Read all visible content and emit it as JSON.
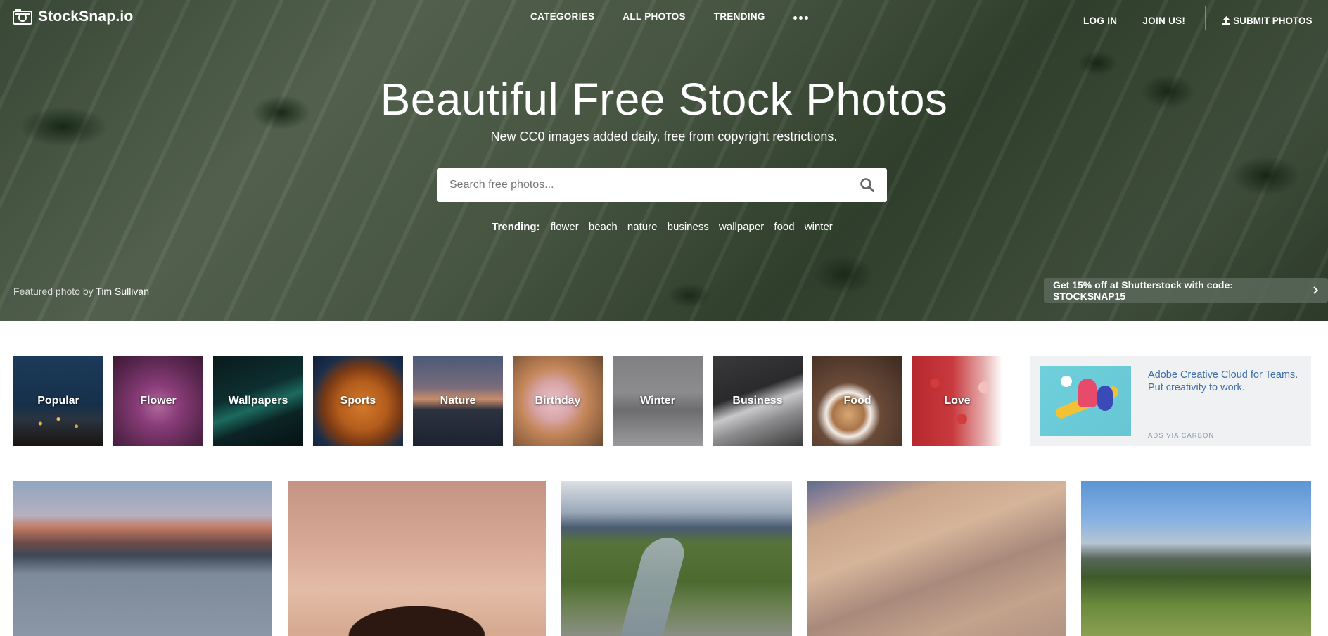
{
  "header": {
    "logo_text": "StockSnap.io",
    "nav": [
      "CATEGORIES",
      "ALL PHOTOS",
      "TRENDING"
    ],
    "login": "LOG IN",
    "join": "JOIN US!",
    "submit": "SUBMIT PHOTOS"
  },
  "hero": {
    "title": "Beautiful Free Stock Photos",
    "subtitle_prefix": "New CC0 images added daily,",
    "subtitle_link": "free from copyright restrictions.",
    "search": {
      "placeholder": "Search free photos...",
      "value": ""
    },
    "trending_label": "Trending:",
    "trending_tags": [
      "flower",
      "beach",
      "nature",
      "business",
      "wallpaper",
      "food",
      "winter"
    ],
    "featured_prefix": "Featured photo by",
    "featured_author": "Tim Sullivan",
    "promo": "Get 15% off at Shutterstock with code: STOCKSNAP15"
  },
  "categories": [
    "Popular",
    "Flower",
    "Wallpapers",
    "Sports",
    "Nature",
    "Birthday",
    "Winter",
    "Business",
    "Food",
    "Love"
  ],
  "ad": {
    "title": "Adobe Creative Cloud for Teams. Put creativity to work.",
    "via": "ADS VIA CARBON"
  },
  "icons": {
    "logo": "camera-icon",
    "more": "more-dots-icon",
    "submit": "upload-icon",
    "search": "search-icon",
    "promo": "chevron-right-icon"
  },
  "colors": {
    "ad_link": "#3d6fa8",
    "ad_background": "#f0f1f3"
  }
}
